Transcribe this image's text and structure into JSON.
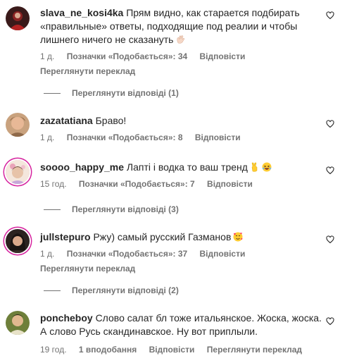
{
  "comments": [
    {
      "username": "slava_ne_kosi4ka",
      "text": "Прям видно, как старается подбирать «правильные» ответы, подходящие под реалии и чтобы лишнего ничего не сказануть",
      "time": "1 д.",
      "likes": "Позначки «Подобається»: 34",
      "reply": "Відповісти",
      "translate": "Переглянути переклад",
      "view_replies": "Переглянути відповіді (1)",
      "emoji": "waving-hand-emoji"
    },
    {
      "username": "zazatatiana",
      "text": "Браво!",
      "time": "1 д.",
      "likes": "Позначки «Подобається»: 8",
      "reply": "Відповісти"
    },
    {
      "username": "soooo_happy_me",
      "text": "Лапті і водка то ваш тренд",
      "time": "15 год.",
      "likes": "Позначки «Подобається»: 7",
      "reply": "Відповісти",
      "view_replies": "Переглянути відповіді (3)",
      "emoji": "victory-hand-and-laughing-face-emoji"
    },
    {
      "username": "jullstepuro",
      "text": "Ржу) самый русский Газманов",
      "time": "1 д.",
      "likes": "Позначки «Подобається»: 37",
      "reply": "Відповісти",
      "translate": "Переглянути переклад",
      "view_replies": "Переглянути відповіді (2)",
      "emoji": "smiling-face-with-hearts-emoji"
    },
    {
      "username": "poncheboy",
      "text": "Слово салат бл тоже итальянское. Жоска, жоска. А слово Русь скандинавское. Ну вот приплыли.",
      "time": "19 год.",
      "likes": "1 вподобання",
      "reply": "Відповісти",
      "translate": "Переглянути переклад"
    }
  ],
  "icons": {
    "like": "heart-outline-icon"
  },
  "colors": {
    "text": "#262626",
    "secondary": "#737373",
    "story_ring": "#d6249f"
  }
}
